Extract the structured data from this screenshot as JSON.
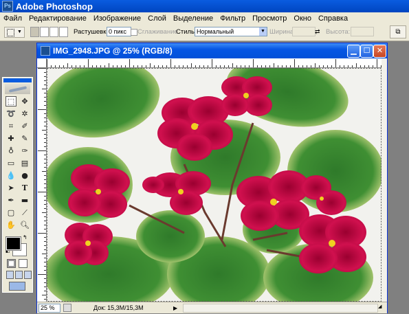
{
  "app": {
    "title": "Adobe Photoshop",
    "icon": "photoshop-icon"
  },
  "menu": [
    "Файл",
    "Редактирование",
    "Изображение",
    "Слой",
    "Выделение",
    "Фильтр",
    "Просмотр",
    "Окно",
    "Справка"
  ],
  "options_bar": {
    "feather_label": "Растушевка:",
    "feather_value": "0 пикс",
    "antialias_label": "Сглаживание",
    "style_label": "Стиль:",
    "style_value": "Нормальный",
    "width_label": "Ширина:",
    "height_label": "Высота:"
  },
  "toolbox": {
    "tools": [
      "rectangular-marquee",
      "move",
      "lasso",
      "magic-wand",
      "crop",
      "slice",
      "healing-brush",
      "brush",
      "clone-stamp",
      "history-brush",
      "eraser",
      "gradient",
      "blur",
      "dodge",
      "path-selection",
      "type",
      "pen",
      "rectangle",
      "notes",
      "eyedropper",
      "hand",
      "zoom"
    ],
    "foreground_color": "#000000",
    "background_color": "#ffffff"
  },
  "document": {
    "title": "IMG_2948.JPG @ 25% (RGB/8)",
    "zoom": "25 %",
    "doc_info": "Док: 15,3M/15,3M"
  },
  "colors": {
    "title_bar": "#0a5ce0",
    "chrome": "#ece9d8",
    "workspace": "#808080"
  }
}
